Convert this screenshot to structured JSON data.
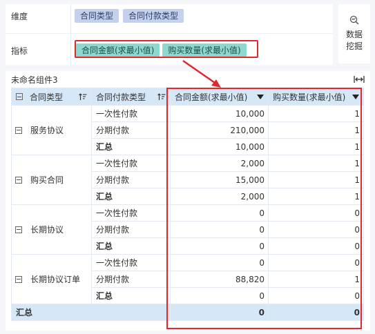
{
  "config": {
    "dimension_label": "维度",
    "dimensions": [
      "合同类型",
      "合同付款类型"
    ],
    "measure_label": "指标",
    "measures": [
      "合同金额(求最小值)",
      "购买数量(求最小值)"
    ]
  },
  "side": {
    "data_mining_label": "数据挖掘",
    "icon": "magnify-chart-icon"
  },
  "widget": {
    "title": "未命名组件3",
    "columns": [
      "合同类型",
      "合同付款类型",
      "合同金额(求最小值)",
      "购买数量(求最小值)"
    ],
    "groups": [
      {
        "name": "服务协议",
        "rows": [
          {
            "type": "一次性付款",
            "amount": "10,000",
            "qty": "1"
          },
          {
            "type": "分期付款",
            "amount": "210,000",
            "qty": "1"
          },
          {
            "type": "汇总",
            "amount": "10,000",
            "qty": "1"
          }
        ]
      },
      {
        "name": "购买合同",
        "rows": [
          {
            "type": "一次性付款",
            "amount": "2,000",
            "qty": "1"
          },
          {
            "type": "分期付款",
            "amount": "15,000",
            "qty": "1"
          },
          {
            "type": "汇总",
            "amount": "2,000",
            "qty": "1"
          }
        ]
      },
      {
        "name": "长期协议",
        "rows": [
          {
            "type": "一次性付款",
            "amount": "0",
            "qty": "0"
          },
          {
            "type": "分期付款",
            "amount": "0",
            "qty": "0"
          },
          {
            "type": "汇总",
            "amount": "0",
            "qty": "0"
          }
        ]
      },
      {
        "name": "长期协议订单",
        "rows": [
          {
            "type": "一次性付款",
            "amount": "0",
            "qty": "0"
          },
          {
            "type": "分期付款",
            "amount": "88,820",
            "qty": "1"
          },
          {
            "type": "汇总",
            "amount": "0",
            "qty": "0"
          }
        ]
      }
    ],
    "total": {
      "label": "汇总",
      "amount": "0",
      "qty": "0"
    }
  },
  "colors": {
    "highlight": "#e2262c",
    "header_bg": "#d6e7f7",
    "dim_chip": "#c5d1ec",
    "measure_chip": "#8fd8d0"
  }
}
